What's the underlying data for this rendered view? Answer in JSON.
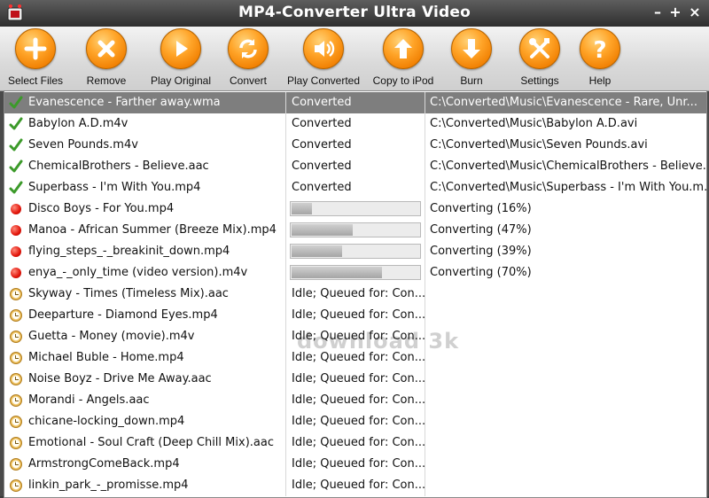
{
  "window": {
    "title": "MP4-Converter Ultra Video"
  },
  "toolbar": [
    {
      "id": "select-files",
      "label": "Select Files",
      "icon": "plus-icon"
    },
    {
      "id": "remove",
      "label": "Remove",
      "icon": "x-icon"
    },
    {
      "id": "play-original",
      "label": "Play Original",
      "icon": "play-icon"
    },
    {
      "id": "convert",
      "label": "Convert",
      "icon": "refresh-icon"
    },
    {
      "id": "play-converted",
      "label": "Play Converted",
      "icon": "speaker-icon"
    },
    {
      "id": "copy-to-ipod",
      "label": "Copy to iPod",
      "icon": "arrow-up-icon"
    },
    {
      "id": "burn",
      "label": "Burn",
      "icon": "arrow-down-icon"
    },
    {
      "id": "settings",
      "label": "Settings",
      "icon": "tools-icon"
    },
    {
      "id": "help",
      "label": "Help",
      "icon": "question-icon"
    }
  ],
  "colors": {
    "accent": "#f58a0c",
    "titlebar": "#3c3c3c",
    "selected_row": "#7e7e7e",
    "status_converting": "#e2140a",
    "status_done": "#3c9a2a"
  },
  "files": [
    {
      "name": "Evanescence - Farther away.wma",
      "state": "done",
      "status": "Converted",
      "output": "C:\\Converted\\Music\\Evanescence - Rare, Unr...",
      "selected": true
    },
    {
      "name": "Babylon A.D.m4v",
      "state": "done",
      "status": "Converted",
      "output": "C:\\Converted\\Music\\Babylon A.D.avi"
    },
    {
      "name": "Seven Pounds.m4v",
      "state": "done",
      "status": "Converted",
      "output": "C:\\Converted\\Music\\Seven Pounds.avi"
    },
    {
      "name": "ChemicalBrothers - Believe.aac",
      "state": "done",
      "status": "Converted",
      "output": "C:\\Converted\\Music\\ChemicalBrothers - Believe..."
    },
    {
      "name": "Superbass - I'm With You.mp4",
      "state": "done",
      "status": "Converted",
      "output": "C:\\Converted\\Music\\Superbass - I'm With You.m..."
    },
    {
      "name": "Disco Boys - For You.mp4",
      "state": "converting",
      "progress": 16,
      "output": "Converting (16%)"
    },
    {
      "name": "Manoa - African Summer (Breeze Mix).mp4",
      "state": "converting",
      "progress": 47,
      "output": "Converting (47%)"
    },
    {
      "name": "flying_steps_-_breakinit_down.mp4",
      "state": "converting",
      "progress": 39,
      "output": "Converting (39%)"
    },
    {
      "name": "enya_-_only_time (video version).m4v",
      "state": "converting",
      "progress": 70,
      "output": "Converting (70%)"
    },
    {
      "name": "Skyway - Times (Timeless Mix).aac",
      "state": "idle",
      "status": "Idle; Queued for: Con...",
      "output": ""
    },
    {
      "name": "Deeparture - Diamond Eyes.mp4",
      "state": "idle",
      "status": "Idle; Queued for: Con...",
      "output": ""
    },
    {
      "name": "Guetta - Money (movie).m4v",
      "state": "idle",
      "status": "Idle; Queued for: Con...",
      "output": ""
    },
    {
      "name": "Michael Buble - Home.mp4",
      "state": "idle",
      "status": "Idle; Queued for: Con...",
      "output": ""
    },
    {
      "name": "Noise Boyz - Drive Me Away.aac",
      "state": "idle",
      "status": "Idle; Queued for: Con...",
      "output": ""
    },
    {
      "name": "Morandi - Angels.aac",
      "state": "idle",
      "status": "Idle; Queued for: Con...",
      "output": ""
    },
    {
      "name": "chicane-locking_down.mp4",
      "state": "idle",
      "status": "Idle; Queued for: Con...",
      "output": ""
    },
    {
      "name": "Emotional - Soul Craft (Deep Chill Mix).aac",
      "state": "idle",
      "status": "Idle; Queued for: Con...",
      "output": ""
    },
    {
      "name": "ArmstrongComeBack.mp4",
      "state": "idle",
      "status": "Idle; Queued for: Con...",
      "output": ""
    },
    {
      "name": "linkin_park_-_promisse.mp4",
      "state": "idle",
      "status": "Idle; Queued for: Con...",
      "output": ""
    }
  ]
}
